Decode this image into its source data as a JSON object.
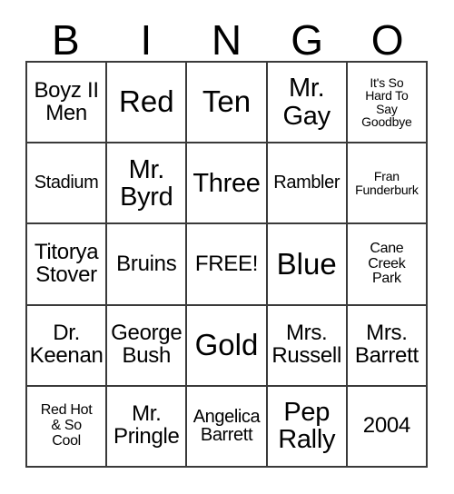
{
  "card": {
    "header_letters": [
      "B",
      "I",
      "N",
      "G",
      "O"
    ],
    "columns": [
      {
        "letter": "B",
        "cells": [
          {
            "text": "Boyz II\nMen",
            "size": "md"
          },
          {
            "text": "Stadium",
            "size": "sm"
          },
          {
            "text": "Titorya\nStover",
            "size": "md"
          },
          {
            "text": "Dr.\nKeenan",
            "size": "md"
          },
          {
            "text": "Red Hot\n& So\nCool",
            "size": "xs"
          }
        ]
      },
      {
        "letter": "I",
        "cells": [
          {
            "text": "Red",
            "size": "xl"
          },
          {
            "text": "Mr.\nByrd",
            "size": "lg"
          },
          {
            "text": "Bruins",
            "size": "md"
          },
          {
            "text": "George\nBush",
            "size": "md"
          },
          {
            "text": "Mr.\nPringle",
            "size": "md"
          }
        ]
      },
      {
        "letter": "N",
        "cells": [
          {
            "text": "Ten",
            "size": "xl"
          },
          {
            "text": "Three",
            "size": "lg"
          },
          {
            "text": "FREE!",
            "size": "md"
          },
          {
            "text": "Gold",
            "size": "xl"
          },
          {
            "text": "Angelica\nBarrett",
            "size": "sm"
          }
        ]
      },
      {
        "letter": "G",
        "cells": [
          {
            "text": "Mr.\nGay",
            "size": "lg"
          },
          {
            "text": "Rambler",
            "size": "sm"
          },
          {
            "text": "Blue",
            "size": "xl"
          },
          {
            "text": "Mrs.\nRussell",
            "size": "md"
          },
          {
            "text": "Pep\nRally",
            "size": "lg"
          }
        ]
      },
      {
        "letter": "O",
        "cells": [
          {
            "text": "It's So\nHard To\nSay\nGoodbye",
            "size": "xxs"
          },
          {
            "text": "Fran\nFunderburk",
            "size": "xxs"
          },
          {
            "text": "Cane\nCreek\nPark",
            "size": "xs"
          },
          {
            "text": "Mrs.\nBarrett",
            "size": "md"
          },
          {
            "text": "2004",
            "size": "md"
          }
        ]
      }
    ],
    "free_space_label": "FREE!",
    "colors": {
      "background": "#ffffff",
      "border": "#3a3a3a",
      "text": "#000000"
    }
  }
}
